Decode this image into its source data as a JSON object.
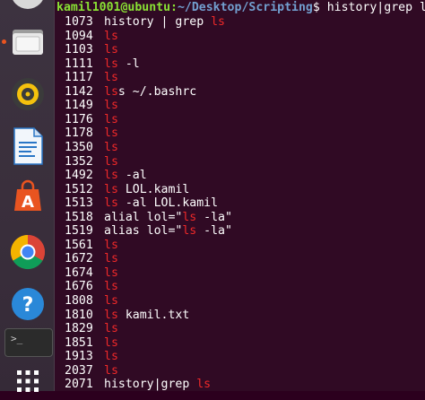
{
  "terminal": {
    "prompt": {
      "user_host": "kamil1001@ubuntu:",
      "path": "~/Desktop/Scripting",
      "symbol": "$ ",
      "command": "history|grep ls"
    },
    "highlight_color": "#ef2929",
    "lines": [
      {
        "num": "1073",
        "pre": "history | grep ",
        "hl": "ls",
        "post": ""
      },
      {
        "num": "1094",
        "pre": "",
        "hl": "ls",
        "post": ""
      },
      {
        "num": "1103",
        "pre": "",
        "hl": "ls",
        "post": ""
      },
      {
        "num": "1111",
        "pre": "",
        "hl": "ls",
        "post": " -l"
      },
      {
        "num": "1117",
        "pre": "",
        "hl": "ls",
        "post": ""
      },
      {
        "num": "1142",
        "pre": "",
        "hl": "ls",
        "post": "s ~/.bashrc"
      },
      {
        "num": "1149",
        "pre": "",
        "hl": "ls",
        "post": ""
      },
      {
        "num": "1176",
        "pre": "",
        "hl": "ls",
        "post": ""
      },
      {
        "num": "1178",
        "pre": "",
        "hl": "ls",
        "post": ""
      },
      {
        "num": "1350",
        "pre": "",
        "hl": "ls",
        "post": ""
      },
      {
        "num": "1352",
        "pre": "",
        "hl": "ls",
        "post": ""
      },
      {
        "num": "1492",
        "pre": "",
        "hl": "ls",
        "post": " -al"
      },
      {
        "num": "1512",
        "pre": "",
        "hl": "ls",
        "post": " LOL.kamil"
      },
      {
        "num": "1513",
        "pre": "",
        "hl": "ls",
        "post": " -al LOL.kamil"
      },
      {
        "num": "1518",
        "pre": "alial lol=\"",
        "hl": "ls",
        "post": " -la\""
      },
      {
        "num": "1519",
        "pre": "alias lol=\"",
        "hl": "ls",
        "post": " -la\""
      },
      {
        "num": "1561",
        "pre": "",
        "hl": "ls",
        "post": ""
      },
      {
        "num": "1672",
        "pre": "",
        "hl": "ls",
        "post": ""
      },
      {
        "num": "1674",
        "pre": "",
        "hl": "ls",
        "post": ""
      },
      {
        "num": "1676",
        "pre": "",
        "hl": "ls",
        "post": ""
      },
      {
        "num": "1808",
        "pre": "",
        "hl": "ls",
        "post": ""
      },
      {
        "num": "1810",
        "pre": "",
        "hl": "ls",
        "post": " kamil.txt"
      },
      {
        "num": "1829",
        "pre": "",
        "hl": "ls",
        "post": ""
      },
      {
        "num": "1851",
        "pre": "",
        "hl": "ls",
        "post": ""
      },
      {
        "num": "1913",
        "pre": "",
        "hl": "ls",
        "post": ""
      },
      {
        "num": "2037",
        "pre": "",
        "hl": "ls",
        "post": ""
      },
      {
        "num": "2071",
        "pre": "history|grep ",
        "hl": "ls",
        "post": ""
      }
    ]
  },
  "launcher": {
    "items": [
      {
        "icon": "files-icon"
      },
      {
        "icon": "rhythmbox-icon"
      },
      {
        "icon": "libreoffice-writer-icon"
      },
      {
        "icon": "ubuntu-software-icon"
      },
      {
        "icon": "chromium-icon"
      },
      {
        "icon": "help-icon"
      },
      {
        "icon": "terminal-icon",
        "label": ">_"
      },
      {
        "icon": "show-applications-icon"
      }
    ]
  }
}
